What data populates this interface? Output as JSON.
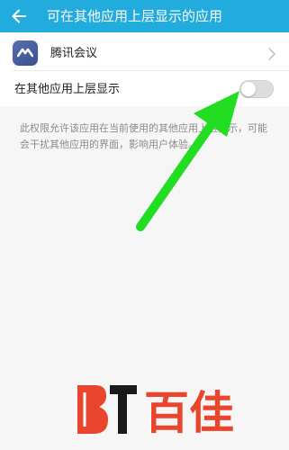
{
  "header": {
    "title": "可在其他应用上层显示的应用",
    "back_icon": "arrow-left-icon",
    "background": "#22acde"
  },
  "app": {
    "name": "腾讯会议",
    "icon": "tencent-meeting-logo-icon"
  },
  "setting": {
    "label": "在其他应用上层显示",
    "enabled": false
  },
  "description": "此权限允许该应用在当前使用的其他应用上层显示，可能会干扰其他应用的界面，影响用户体验。",
  "overlay": {
    "arrow_color": "#22dd22",
    "watermark_text": "百佳",
    "watermark_color": "#e8452c"
  }
}
